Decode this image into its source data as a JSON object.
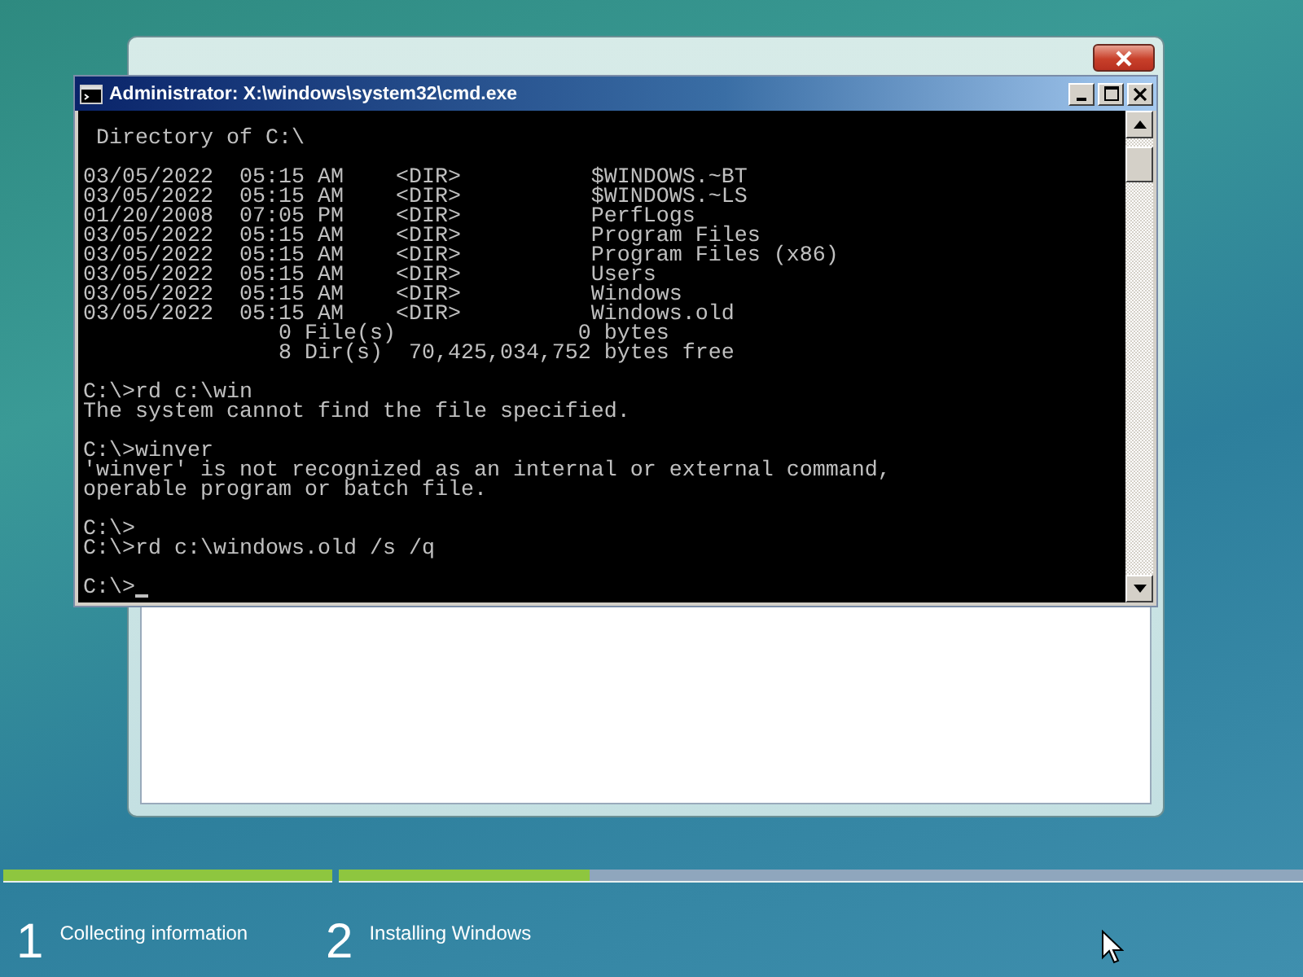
{
  "console_window": {
    "title": "Administrator: X:\\windows\\system32\\cmd.exe",
    "blocks": [
      [
        " Directory of C:\\"
      ],
      [
        "03/05/2022  05:15 AM    <DIR>          $WINDOWS.~BT",
        "03/05/2022  05:15 AM    <DIR>          $WINDOWS.~LS",
        "01/20/2008  07:05 PM    <DIR>          PerfLogs",
        "03/05/2022  05:15 AM    <DIR>          Program Files",
        "03/05/2022  05:15 AM    <DIR>          Program Files (x86)",
        "03/05/2022  05:15 AM    <DIR>          Users",
        "03/05/2022  05:15 AM    <DIR>          Windows",
        "03/05/2022  05:15 AM    <DIR>          Windows.old",
        "               0 File(s)              0 bytes",
        "               8 Dir(s)  70,425,034,752 bytes free"
      ],
      [
        "C:\\>rd c:\\win",
        "The system cannot find the file specified."
      ],
      [
        "C:\\>winver",
        "'winver' is not recognized as an internal or external command,",
        "operable program or batch file."
      ],
      [
        "C:\\>",
        "C:\\>rd c:\\windows.old /s /q"
      ],
      [
        "C:\\>"
      ]
    ],
    "cursor": true
  },
  "progress": {
    "bars": [
      {
        "level": 1
      },
      {
        "level": 0.26
      }
    ],
    "steps": [
      {
        "number": "1",
        "label": "Collecting information"
      },
      {
        "number": "2",
        "label": "Installing Windows"
      }
    ]
  }
}
